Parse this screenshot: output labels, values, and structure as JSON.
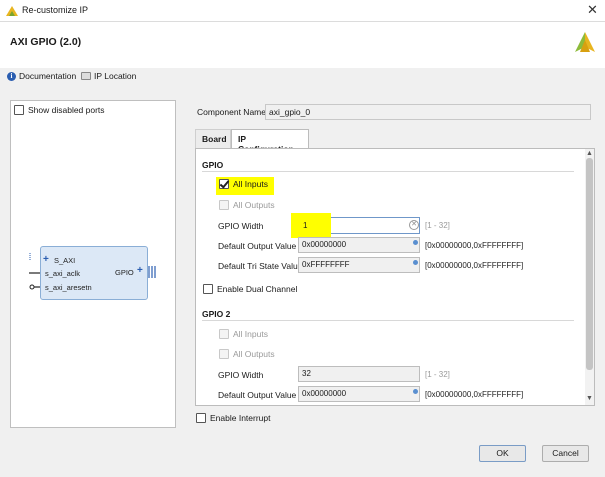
{
  "window": {
    "title": "Re-customize IP"
  },
  "ip": {
    "name": "AXI GPIO (2.0)"
  },
  "links": {
    "documentation": "Documentation",
    "ip_location": "IP Location"
  },
  "left_panel": {
    "show_disabled_ports": "Show disabled ports",
    "symbol": {
      "s_axi": "S_AXI",
      "s_axi_aclk": "s_axi_aclk",
      "s_axi_aresetn": "s_axi_aresetn",
      "gpio": "GPIO"
    }
  },
  "component": {
    "label": "Component Name",
    "value": "axi_gpio_0"
  },
  "tabs": [
    {
      "label": "Board"
    },
    {
      "label": "IP Configuration"
    }
  ],
  "gpio": {
    "title": "GPIO",
    "all_inputs": "All Inputs",
    "all_inputs_checked": true,
    "all_outputs": "All Outputs",
    "width_label": "GPIO Width",
    "width_value": "1",
    "width_range": "[1 - 32]",
    "default_output_label": "Default Output Value",
    "default_output_value": "0x00000000",
    "default_output_range": "[0x00000000,0xFFFFFFFF]",
    "default_tri_label": "Default Tri State Value",
    "default_tri_value": "0xFFFFFFFF",
    "default_tri_range": "[0x00000000,0xFFFFFFFF]",
    "enable_dual": "Enable Dual Channel"
  },
  "gpio2": {
    "title": "GPIO 2",
    "all_inputs": "All Inputs",
    "all_outputs": "All Outputs",
    "width_label": "GPIO Width",
    "width_value": "32",
    "width_range": "[1 - 32]",
    "default_output_label": "Default Output Value",
    "default_output_value": "0x00000000",
    "default_output_range": "[0x00000000,0xFFFFFFFF]"
  },
  "enable_interrupt": "Enable Interrupt",
  "buttons": {
    "ok": "OK",
    "cancel": "Cancel"
  },
  "colors": {
    "highlight": "#ffff00",
    "brand": "#e8b520",
    "info": "#2a5db0"
  }
}
